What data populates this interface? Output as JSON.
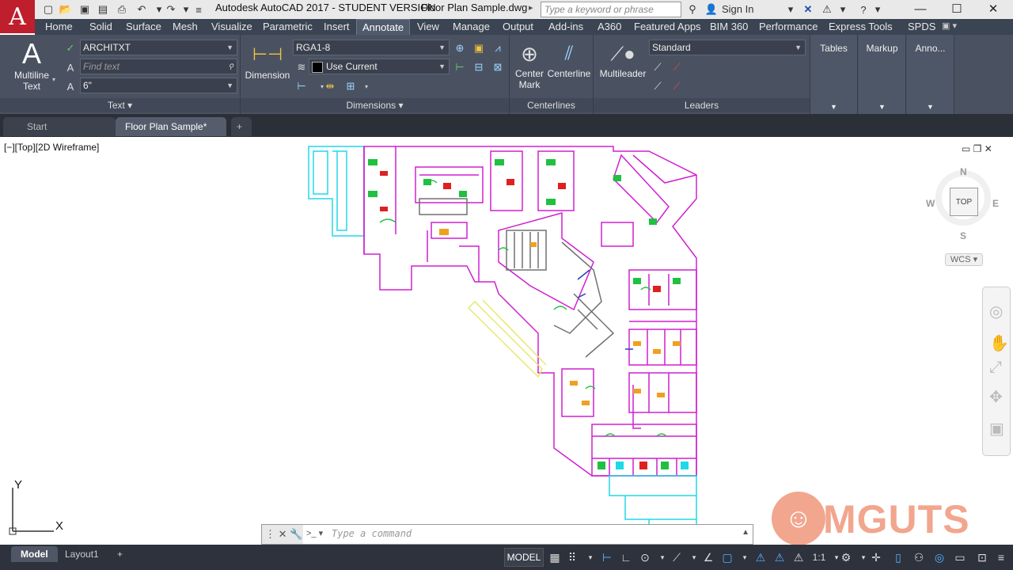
{
  "title": {
    "app": "Autodesk AutoCAD 2017 - STUDENT VERSION",
    "file": "Floor Plan Sample.dwg",
    "search_placeholder": "Type a keyword or phrase",
    "sign_in": "Sign In"
  },
  "ribbon_tabs": [
    "Home",
    "Solid",
    "Surface",
    "Mesh",
    "Visualize",
    "Parametric",
    "Insert",
    "Annotate",
    "View",
    "Manage",
    "Output",
    "Add-ins",
    "A360",
    "Featured Apps",
    "BIM 360",
    "Performance",
    "Express Tools",
    "SPDS"
  ],
  "active_tab": "Annotate",
  "text_panel": {
    "big_button": "Multiline Text",
    "big_button_line1": "Multiline",
    "big_button_line2": "Text",
    "style": "ARCHITXT",
    "find_placeholder": "Find text",
    "height": "6\"",
    "title": "Text"
  },
  "dimensions_panel": {
    "big_button": "Dimension",
    "dimstyle": "RGA1-8",
    "layer": "Use Current",
    "title": "Dimensions"
  },
  "centerlines_panel": {
    "center_mark_line1": "Center",
    "center_mark_line2": "Mark",
    "centerline": "Centerline",
    "title": "Centerlines"
  },
  "leaders_panel": {
    "big_button": "Multileader",
    "style": "Standard",
    "title": "Leaders"
  },
  "extra_panels": [
    "Tables",
    "Markup",
    "Anno..."
  ],
  "doc_tabs": [
    "Start",
    "Floor Plan Sample*"
  ],
  "active_doc": "Floor Plan Sample*",
  "viewport_label": "[−][Top][2D Wireframe]",
  "viewcube": {
    "top": "TOP",
    "n": "N",
    "s": "S",
    "e": "E",
    "w": "W",
    "wcs": "WCS"
  },
  "ucs": {
    "x": "X",
    "y": "Y"
  },
  "command_placeholder": "Type a command",
  "layout_tabs": [
    "Model",
    "Layout1"
  ],
  "status": {
    "model": "MODEL",
    "scale": "1:1"
  },
  "watermark": "MGUTS",
  "colors": {
    "magenta": "#d020d0",
    "cyan": "#20d8e8",
    "yellow": "#e8e870",
    "green": "#20c040",
    "red": "#e02020",
    "orange": "#f0a020",
    "gray": "#707070",
    "blue": "#2040c0"
  }
}
